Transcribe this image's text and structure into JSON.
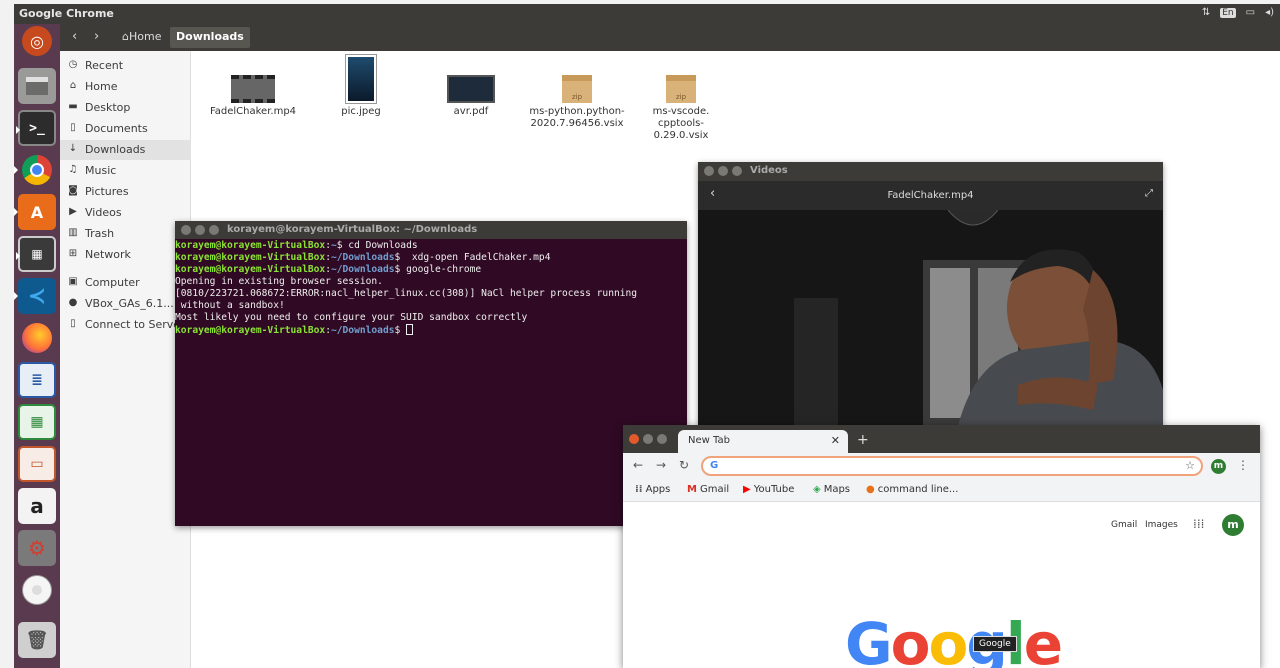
{
  "top_panel": {
    "app_title": "Google Chrome",
    "lang": "En"
  },
  "launcher": {
    "items": [
      "ubuntu-dash",
      "files",
      "terminal",
      "chrome",
      "software-center",
      "video-editor",
      "vscode",
      "firefox",
      "writer",
      "calc",
      "impress",
      "amazon",
      "settings",
      "disc",
      "trash"
    ]
  },
  "files": {
    "breadcrumb": {
      "home": "Home",
      "current": "Downloads"
    },
    "sidebar": [
      {
        "label": "Recent",
        "icon": "clock-icon"
      },
      {
        "label": "Home",
        "icon": "home-icon"
      },
      {
        "label": "Desktop",
        "icon": "folder-icon"
      },
      {
        "label": "Documents",
        "icon": "document-icon"
      },
      {
        "label": "Downloads",
        "icon": "download-icon"
      },
      {
        "label": "Music",
        "icon": "music-icon"
      },
      {
        "label": "Pictures",
        "icon": "camera-icon"
      },
      {
        "label": "Videos",
        "icon": "video-icon"
      },
      {
        "label": "Trash",
        "icon": "trash-icon"
      },
      {
        "label": "Network",
        "icon": "network-icon"
      },
      {
        "label": "Computer",
        "icon": "computer-icon"
      },
      {
        "label": "VBox_GAs_6.1...",
        "icon": "disc-icon"
      },
      {
        "label": "Connect to Server",
        "icon": "server-icon"
      }
    ],
    "items": [
      {
        "name": "FadelChaker.mp4",
        "kind": "video"
      },
      {
        "name": "pic.jpeg",
        "kind": "image"
      },
      {
        "name": "avr.pdf",
        "kind": "pdf"
      },
      {
        "name": "ms-python.python-2020.7.96456.vsix",
        "line1": "ms-python.python-",
        "line2": "2020.7.96456.vsix",
        "kind": "zip",
        "badge": "zip"
      },
      {
        "name": "ms-vscode.cpptools-0.29.0.vsix",
        "line1": "ms-vscode.",
        "line2": "cpptools-0.29.0.vsix",
        "kind": "zip",
        "badge": "zip"
      }
    ]
  },
  "terminal": {
    "title": "korayem@korayem-VirtualBox: ~/Downloads",
    "user": "korayem@korayem-VirtualBox",
    "lines": [
      {
        "path": "~",
        "cmd": " cd Downloads"
      },
      {
        "path": "~/Downloads",
        "cmd": "  xdg-open FadelChaker.mp4"
      },
      {
        "path": "~/Downloads",
        "cmd": " google-chrome"
      }
    ],
    "output": [
      "Opening in existing browser session.",
      "[0810/223721.068672:ERROR:nacl_helper_linux.cc(308)] NaCl helper process running",
      " without a sandbox!",
      "Most likely you need to configure your SUID sandbox correctly"
    ],
    "final_prompt_path": "~/Downloads"
  },
  "videos": {
    "window_title": "Videos",
    "file": "FadelChaker.mp4"
  },
  "chrome": {
    "tab_title": "New Tab",
    "omnibox_icon": "G",
    "profile_initial": "m",
    "bookmarks": [
      "Apps",
      "Gmail",
      "YouTube",
      "Maps",
      "command line..."
    ],
    "links": {
      "gmail": "Gmail",
      "images": "Images"
    },
    "logo": "Google",
    "tooltip": "Google"
  }
}
